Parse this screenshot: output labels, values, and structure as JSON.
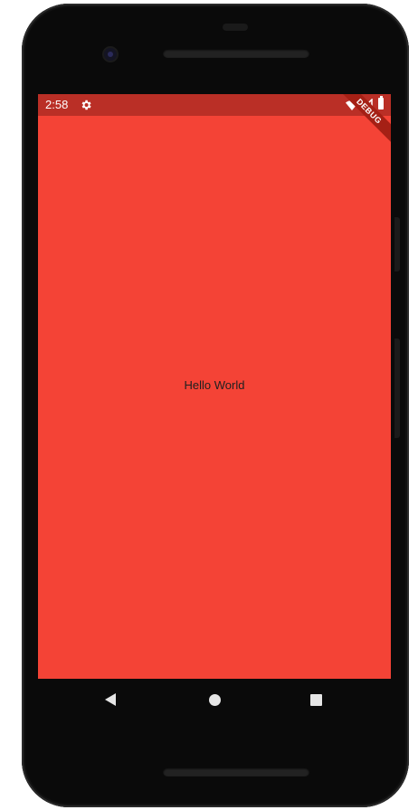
{
  "status_bar": {
    "time": "2:58",
    "icons": [
      "gear-icon",
      "wifi-icon",
      "cell-signal-icon",
      "battery-icon"
    ],
    "color": "#ba2f26"
  },
  "debug_banner": {
    "label": "DEBUG"
  },
  "app": {
    "background_color": "#f44336",
    "body_text": "Hello World"
  },
  "navigation_bar": {
    "buttons": [
      "back-icon",
      "home-icon",
      "recents-icon"
    ]
  }
}
